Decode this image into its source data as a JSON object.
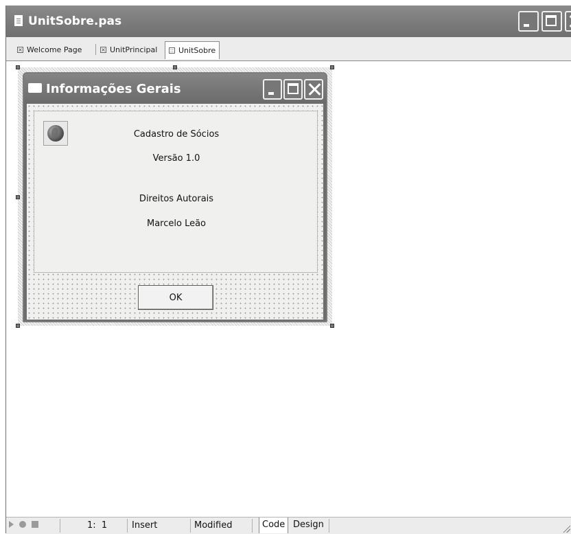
{
  "window": {
    "title": "UnitSobre.pas"
  },
  "tabs": [
    {
      "label": "Welcome Page"
    },
    {
      "label": "UnitPrincipal"
    },
    {
      "label": "UnitSobre"
    }
  ],
  "form": {
    "title": "Informações Gerais",
    "labels": {
      "product": "Cadastro de Sócios",
      "version": "Versão 1.0",
      "copyright": "Direitos Autorais",
      "author": "Marcelo Leão"
    },
    "ok_button": "OK"
  },
  "statusbar": {
    "position": "1:  1",
    "mode": "Insert",
    "state": "Modified",
    "tabs": [
      "Code",
      "Design"
    ]
  }
}
